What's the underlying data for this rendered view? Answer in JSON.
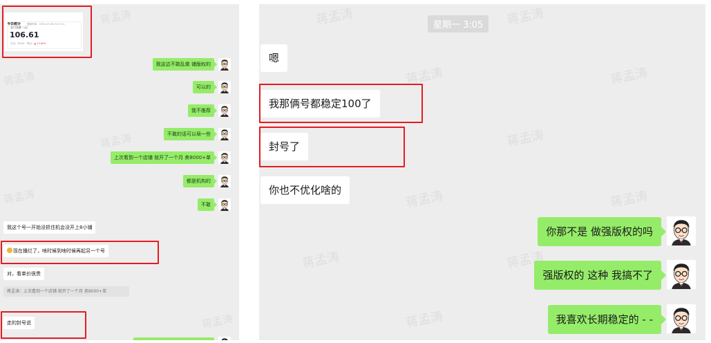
{
  "left_panel": {
    "watermark": "蒋孟涛",
    "stats_card": {
      "title": "今日统计",
      "date": "更新时间：2020-07-06 23:17:21",
      "label": "支付金额（元）",
      "value": "106.61",
      "foot_prefix": "今日：69.80　昨日：",
      "change": "▲ 13.69%"
    },
    "messages_right": [
      "我这边不敢乱做 铺版权的",
      "可以的",
      "我不推荐",
      "不敢的话可以局一些",
      "上次看到一个店铺 就开了一个月 卖8000+单",
      "都是机构的",
      "不敢"
    ],
    "messages_left": [
      "我这个号一开始没抓住机会没开上8小铺",
      "现在播烂了，啥时候到啥时候再起另一个号",
      "对，看单价很贵"
    ],
    "quote_text": "蒋孟涛：上次看到一个店铺 就开了一个月 卖8000+单",
    "last_left": "走的封号说"
  },
  "right_panel": {
    "watermark": "蒋孟涛",
    "time": "星期一 3:05",
    "messages_left": [
      "嗯",
      "我那俩号都稳定100了",
      "封号了",
      "你也不优化啥的"
    ],
    "messages_right": [
      "你那不是 做强版权的吗",
      "强版权的 这种 我搞不了",
      "我喜欢长期稳定的 - -"
    ]
  },
  "colors": {
    "bubble_green": "#95ec69",
    "highlight_red": "#e31b23",
    "chat_bg": "#ededed"
  }
}
